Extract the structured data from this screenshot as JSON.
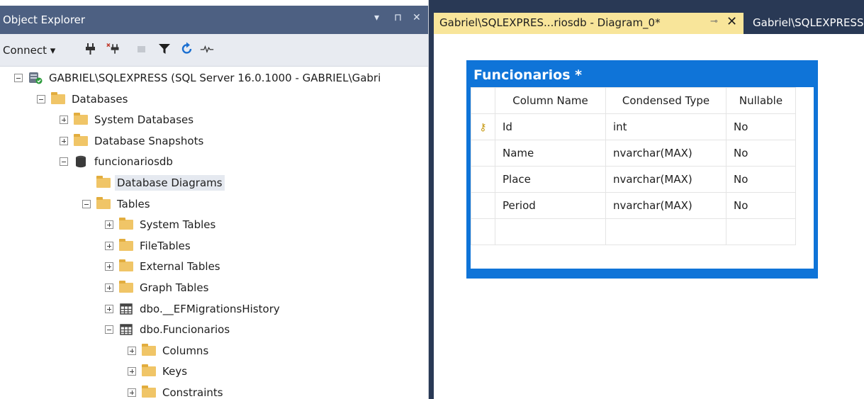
{
  "explorer": {
    "title": "Object Explorer",
    "dropdown_icon": "▾",
    "pin_icon": "⊓",
    "close_icon": "✕",
    "connect_label": "Connect ▾"
  },
  "tree": [
    {
      "label": "GABRIEL\\SQLEXPRESS (SQL Server 16.0.1000 - GABRIEL\\Gabri",
      "icon": "server-icon",
      "exp": "minus",
      "indent": 0
    },
    {
      "label": "Databases",
      "icon": "folder-icon",
      "exp": "minus",
      "indent": 1
    },
    {
      "label": "System Databases",
      "icon": "folder-icon",
      "exp": "plus",
      "indent": 2
    },
    {
      "label": "Database Snapshots",
      "icon": "folder-icon",
      "exp": "plus",
      "indent": 2
    },
    {
      "label": "funcionariosdb",
      "icon": "database-icon",
      "exp": "minus",
      "indent": 2
    },
    {
      "label": "Database Diagrams",
      "icon": "folder-icon",
      "exp": "none",
      "indent": 3,
      "selected": true
    },
    {
      "label": "Tables",
      "icon": "folder-icon",
      "exp": "minus",
      "indent": 3
    },
    {
      "label": "System Tables",
      "icon": "folder-icon",
      "exp": "plus",
      "indent": 4
    },
    {
      "label": "FileTables",
      "icon": "folder-icon",
      "exp": "plus",
      "indent": 4
    },
    {
      "label": "External Tables",
      "icon": "folder-icon",
      "exp": "plus",
      "indent": 4
    },
    {
      "label": "Graph Tables",
      "icon": "folder-icon",
      "exp": "plus",
      "indent": 4
    },
    {
      "label": "dbo.__EFMigrationsHistory",
      "icon": "table-icon",
      "exp": "plus",
      "indent": 4
    },
    {
      "label": "dbo.Funcionarios",
      "icon": "table-icon",
      "exp": "minus",
      "indent": 4
    },
    {
      "label": "Columns",
      "icon": "folder-icon",
      "exp": "plus",
      "indent": 5
    },
    {
      "label": "Keys",
      "icon": "folder-icon",
      "exp": "plus",
      "indent": 5
    },
    {
      "label": "Constraints",
      "icon": "folder-icon",
      "exp": "plus",
      "indent": 5
    }
  ],
  "tabs": {
    "active_label": "Gabriel\\SQLEXPRES...riosdb - Diagram_0*",
    "pin_icon": "⊸",
    "close_icon": "✕",
    "second_label": "Gabriel\\SQLEXPRESS"
  },
  "diagram": {
    "title": "Funcionarios *",
    "headers": [
      "Column Name",
      "Condensed Type",
      "Nullable"
    ],
    "rows": [
      {
        "key": true,
        "name": "Id",
        "type": "int",
        "nullable": "No"
      },
      {
        "key": false,
        "name": "Name",
        "type": "nvarchar(MAX)",
        "nullable": "No"
      },
      {
        "key": false,
        "name": "Place",
        "type": "nvarchar(MAX)",
        "nullable": "No"
      },
      {
        "key": false,
        "name": "Period",
        "type": "nvarchar(MAX)",
        "nullable": "No"
      }
    ],
    "key_icon_glyph": "⚷"
  },
  "colors": {
    "header_bg": "#4d6082",
    "active_tab": "#f8e59a",
    "table_header": "#0f74d8",
    "folder": "#f0c567"
  }
}
